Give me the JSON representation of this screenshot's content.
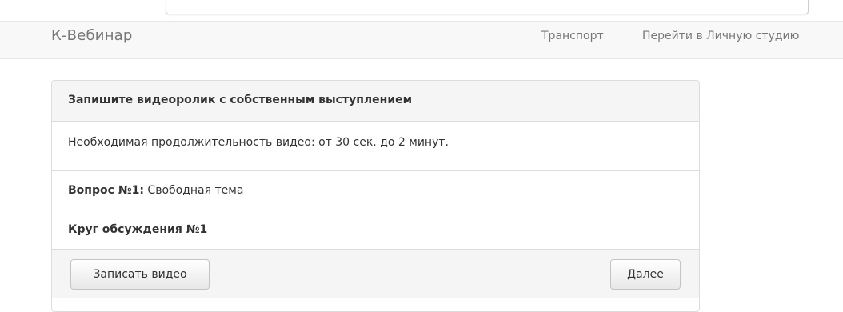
{
  "navbar": {
    "brand": "К-Вебинар",
    "links": [
      {
        "label": "Транспорт"
      },
      {
        "label": "Перейти в Личную студию"
      }
    ]
  },
  "panel": {
    "heading": "Запишите видеоролик с собственным выступлением",
    "duration_text": "Необходимая продолжительность видео: от 30 сек. до 2 минут.",
    "question_label": "Вопрос №1:",
    "question_text": " Свободная тема",
    "round_label": "Круг обсуждения №1",
    "record_button": "Записать видео",
    "next_button": "Далее"
  }
}
